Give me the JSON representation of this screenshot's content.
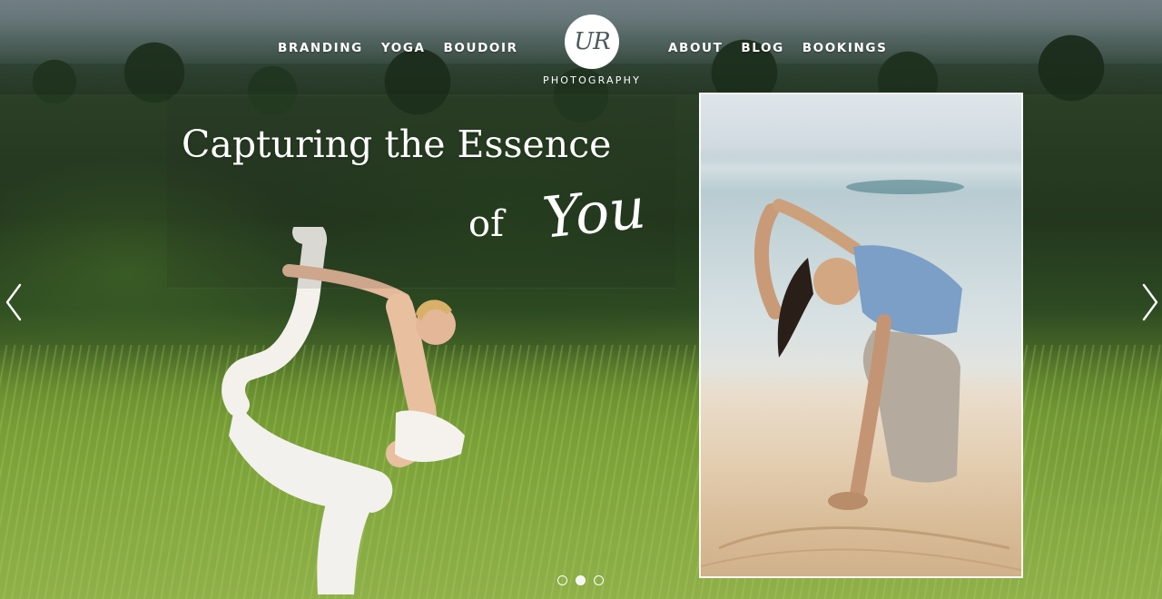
{
  "nav": {
    "left": [
      {
        "label": "BRANDING"
      },
      {
        "label": "YOGA"
      },
      {
        "label": "BOUDOIR"
      }
    ],
    "right": [
      {
        "label": "ABOUT"
      },
      {
        "label": "BLOG"
      },
      {
        "label": "BOOKINGS"
      }
    ]
  },
  "logo": {
    "monogram": "UR",
    "tagline": "PHOTOGRAPHY"
  },
  "hero": {
    "headline_line1": "Capturing the Essence",
    "headline_of": "of",
    "headline_script": "You"
  },
  "slider": {
    "slide_count": 3,
    "active_slide": 2
  },
  "colors": {
    "text": "#ffffff",
    "accent": "#ffffff"
  },
  "icons": {
    "prev": "chevron-left-icon",
    "next": "chevron-right-icon"
  }
}
